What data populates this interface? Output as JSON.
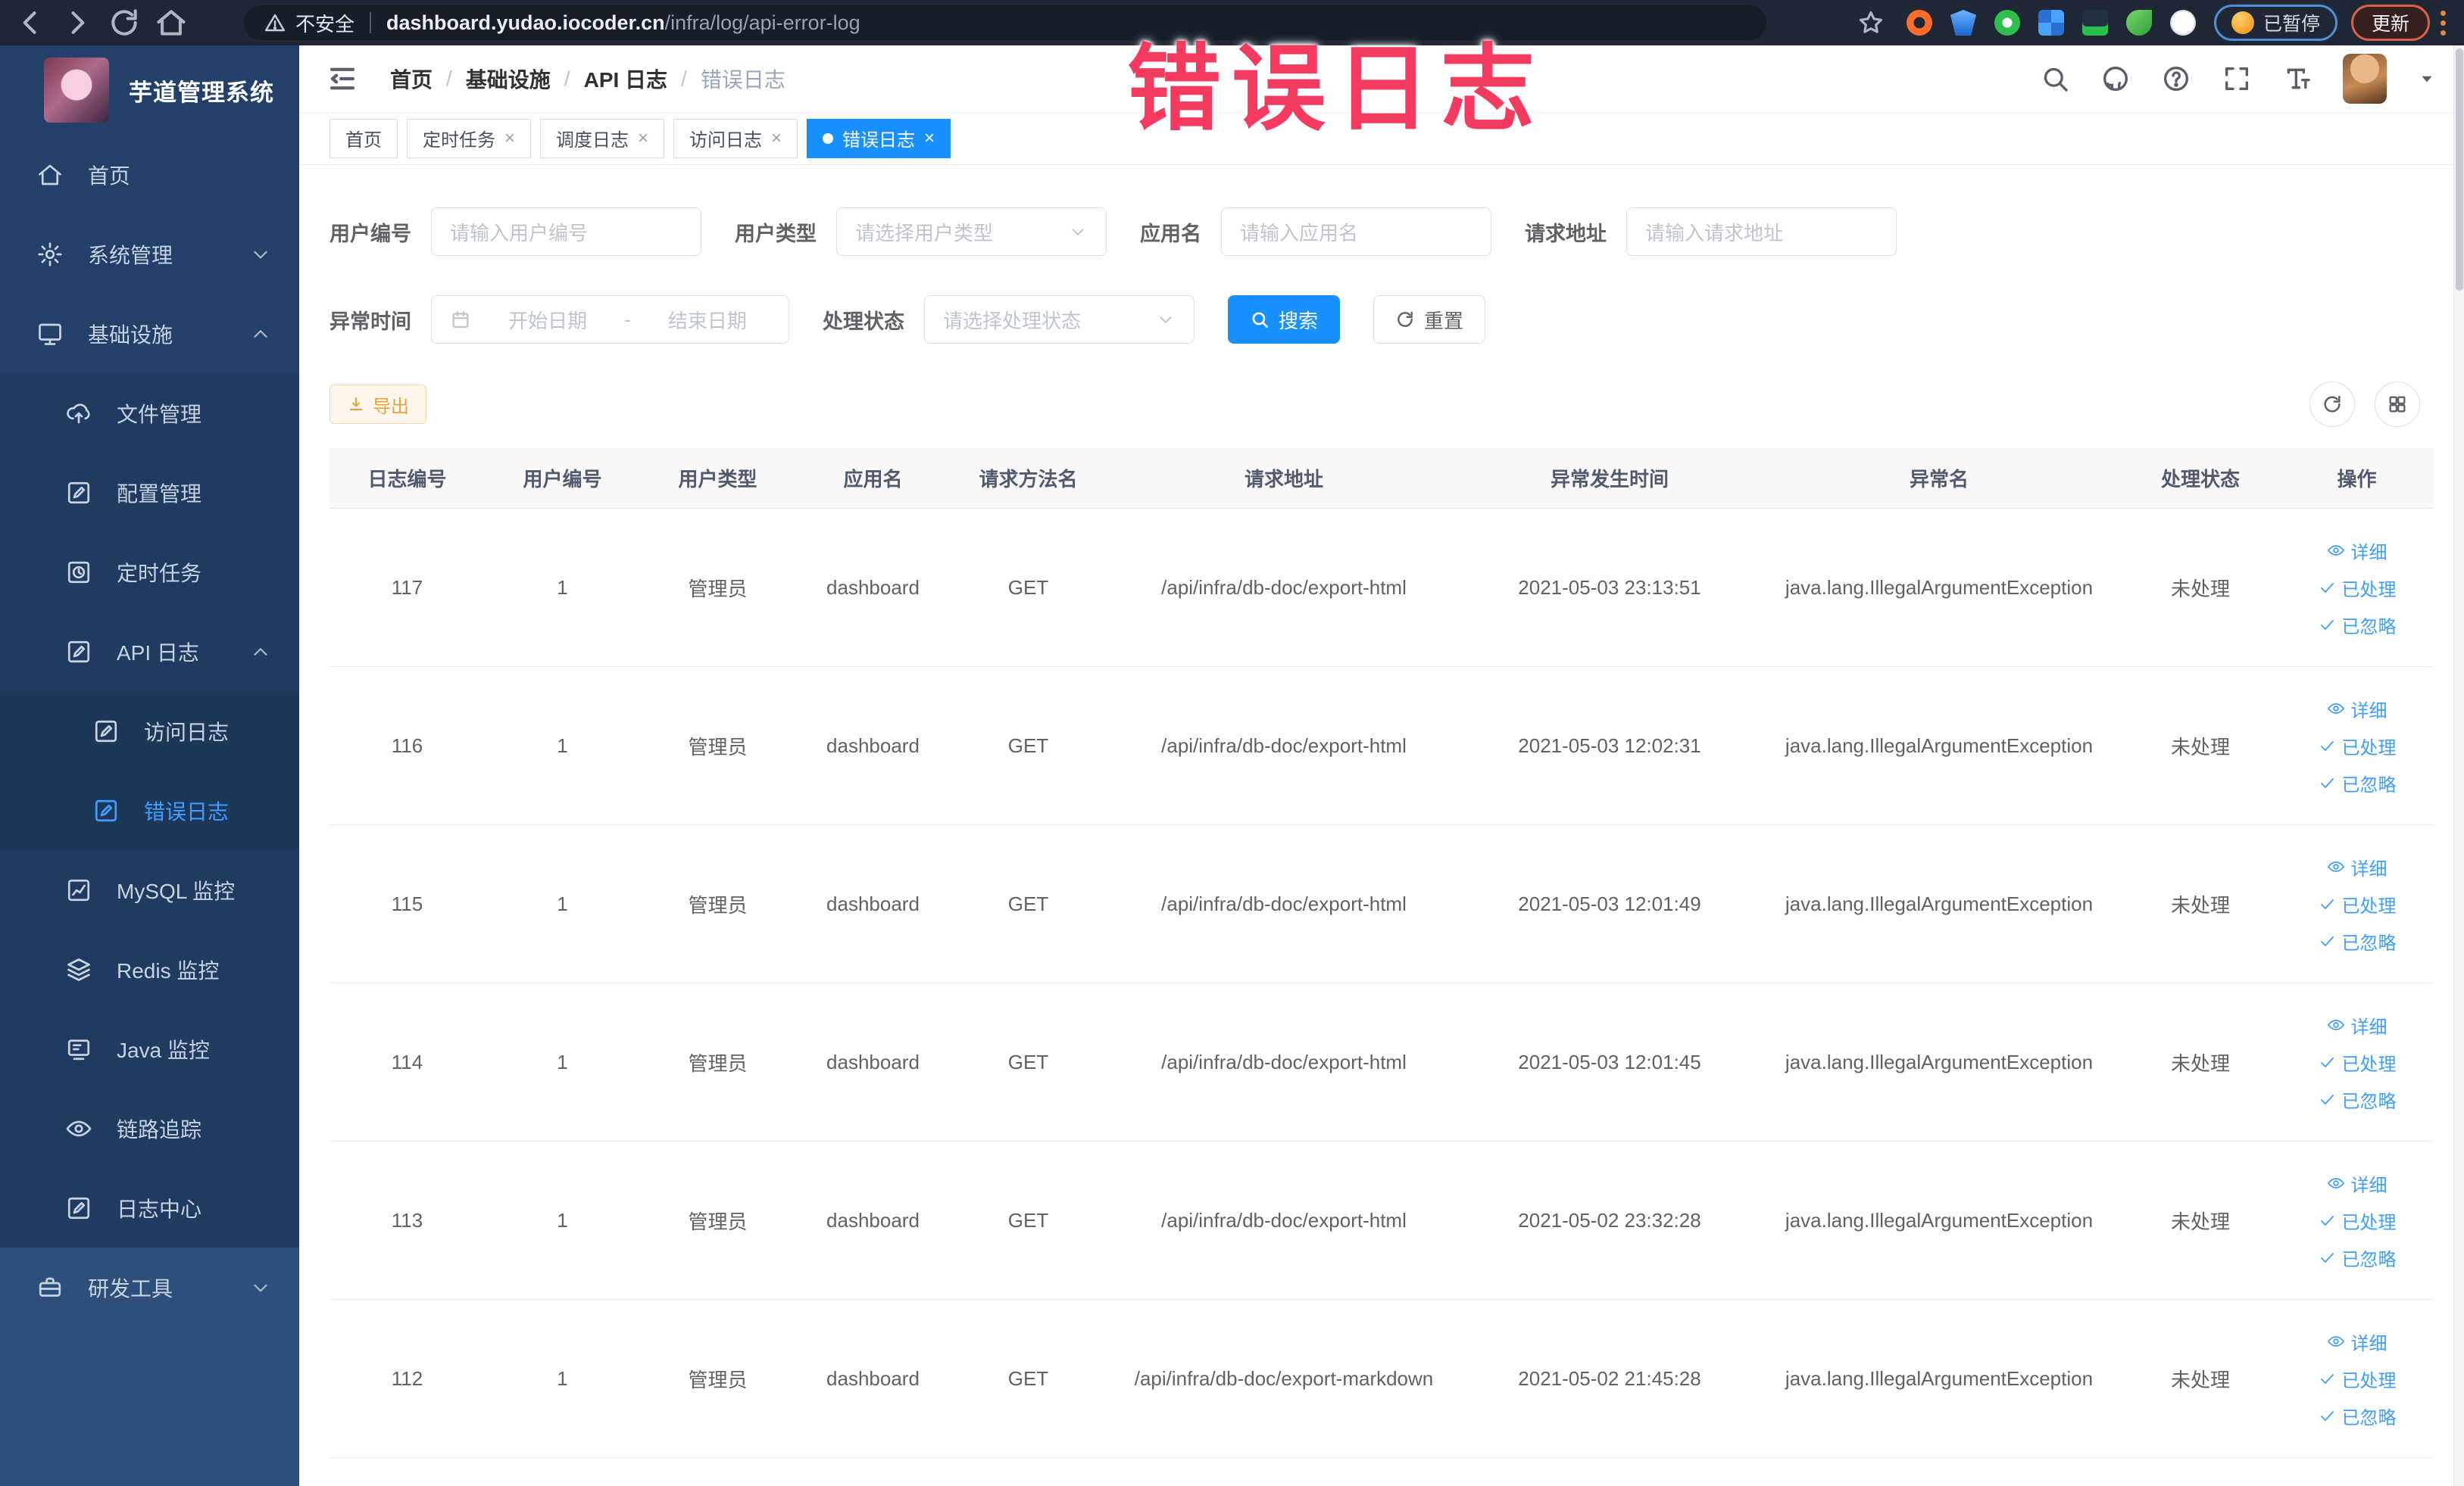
{
  "browser": {
    "security_label": "不安全",
    "url_host": "dashboard.yudao.iocoder.cn",
    "url_path": "/infra/log/api-error-log",
    "paused_badge": "已暂停",
    "update_label": "更新"
  },
  "overlay_title": "错误日志",
  "sidebar": {
    "app_title": "芋道管理系统",
    "items": [
      {
        "icon": "home",
        "label": "首页",
        "level": 0
      },
      {
        "icon": "gear",
        "label": "系统管理",
        "level": 0,
        "chevron": "down"
      },
      {
        "icon": "monitor",
        "label": "基础设施",
        "level": 0,
        "chevron": "up"
      },
      {
        "icon": "cloud-upload",
        "label": "文件管理",
        "level": 1
      },
      {
        "icon": "edit",
        "label": "配置管理",
        "level": 1
      },
      {
        "icon": "timer",
        "label": "定时任务",
        "level": 1
      },
      {
        "icon": "edit",
        "label": "API 日志",
        "level": 1,
        "chevron": "up"
      },
      {
        "icon": "edit",
        "label": "访问日志",
        "level": 2
      },
      {
        "icon": "edit",
        "label": "错误日志",
        "level": 2,
        "active": true
      },
      {
        "icon": "chart",
        "label": "MySQL 监控",
        "level": 1
      },
      {
        "icon": "layers",
        "label": "Redis 监控",
        "level": 1
      },
      {
        "icon": "java",
        "label": "Java 监控",
        "level": 1
      },
      {
        "icon": "eye",
        "label": "链路追踪",
        "level": 1
      },
      {
        "icon": "edit",
        "label": "日志中心",
        "level": 1
      },
      {
        "icon": "toolbox",
        "label": "研发工具",
        "level": 0,
        "chevron": "down",
        "section": "light"
      }
    ]
  },
  "breadcrumb": [
    "首页",
    "基础设施",
    "API 日志",
    "错误日志"
  ],
  "tabs": [
    {
      "label": "首页",
      "closable": false,
      "active": false
    },
    {
      "label": "定时任务",
      "closable": true,
      "active": false
    },
    {
      "label": "调度日志",
      "closable": true,
      "active": false
    },
    {
      "label": "访问日志",
      "closable": true,
      "active": false
    },
    {
      "label": "错误日志",
      "closable": true,
      "active": true
    }
  ],
  "filters": {
    "row1": [
      {
        "label": "用户编号",
        "placeholder": "请输入用户编号",
        "type": "input"
      },
      {
        "label": "用户类型",
        "placeholder": "请选择用户类型",
        "type": "select"
      },
      {
        "label": "应用名",
        "placeholder": "请输入应用名",
        "type": "input"
      },
      {
        "label": "请求地址",
        "placeholder": "请输入请求地址",
        "type": "input"
      }
    ],
    "time_label": "异常时间",
    "date_start_placeholder": "开始日期",
    "date_separator": "-",
    "date_end_placeholder": "结束日期",
    "status_label": "处理状态",
    "status_placeholder": "请选择处理状态",
    "search_label": "搜索",
    "reset_label": "重置"
  },
  "toolbar": {
    "export_label": "导出"
  },
  "table": {
    "columns": [
      "日志编号",
      "用户编号",
      "用户类型",
      "应用名",
      "请求方法名",
      "请求地址",
      "异常发生时间",
      "异常名",
      "处理状态",
      "操作"
    ],
    "action_labels": [
      "详细",
      "已处理",
      "已忽略"
    ],
    "rows": [
      {
        "id": "117",
        "user_id": "1",
        "user_type": "管理员",
        "app": "dashboard",
        "method": "GET",
        "url": "/api/infra/db-doc/export-html",
        "time": "2021-05-03 23:13:51",
        "exception": "java.lang.IllegalArgumentException",
        "status": "未处理"
      },
      {
        "id": "116",
        "user_id": "1",
        "user_type": "管理员",
        "app": "dashboard",
        "method": "GET",
        "url": "/api/infra/db-doc/export-html",
        "time": "2021-05-03 12:02:31",
        "exception": "java.lang.IllegalArgumentException",
        "status": "未处理"
      },
      {
        "id": "115",
        "user_id": "1",
        "user_type": "管理员",
        "app": "dashboard",
        "method": "GET",
        "url": "/api/infra/db-doc/export-html",
        "time": "2021-05-03 12:01:49",
        "exception": "java.lang.IllegalArgumentException",
        "status": "未处理"
      },
      {
        "id": "114",
        "user_id": "1",
        "user_type": "管理员",
        "app": "dashboard",
        "method": "GET",
        "url": "/api/infra/db-doc/export-html",
        "time": "2021-05-03 12:01:45",
        "exception": "java.lang.IllegalArgumentException",
        "status": "未处理"
      },
      {
        "id": "113",
        "user_id": "1",
        "user_type": "管理员",
        "app": "dashboard",
        "method": "GET",
        "url": "/api/infra/db-doc/export-html",
        "time": "2021-05-02 23:32:28",
        "exception": "java.lang.IllegalArgumentException",
        "status": "未处理"
      },
      {
        "id": "112",
        "user_id": "1",
        "user_type": "管理员",
        "app": "dashboard",
        "method": "GET",
        "url": "/api/infra/db-doc/export-markdown",
        "time": "2021-05-02 21:45:28",
        "exception": "java.lang.IllegalArgumentException",
        "status": "未处理"
      }
    ]
  },
  "colors": {
    "accent": "#409eff",
    "active_tab": "#1890ff",
    "warning": "#e6a23c",
    "overlay_pink": "#f43b5f",
    "sidebar_bg": "#22406a"
  }
}
